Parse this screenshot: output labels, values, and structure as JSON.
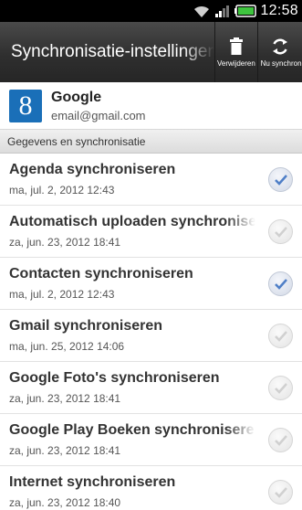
{
  "status_bar": {
    "time": "12:58",
    "icons": [
      "wifi-icon",
      "signal-icon",
      "battery-icon"
    ],
    "battery_color": "#3ec43e"
  },
  "action_bar": {
    "title": "Synchronisatie-instellingen",
    "delete_label": "Verwijderen",
    "sync_label": "Nu synchroniseren"
  },
  "account": {
    "logo_letter": "8",
    "name": "Google",
    "email": "email@gmail.com"
  },
  "section_header": "Gegevens en synchronisatie",
  "items": [
    {
      "label": "Agenda synchroniseren",
      "date": "ma, jul. 2, 2012 12:43",
      "checked": true
    },
    {
      "label": "Automatisch uploaden synchroniseren",
      "date": "za, jun. 23, 2012 18:41",
      "checked": false
    },
    {
      "label": "Contacten synchroniseren",
      "date": "ma, jul. 2, 2012 12:43",
      "checked": true
    },
    {
      "label": "Gmail synchroniseren",
      "date": "ma, jun. 25, 2012 14:06",
      "checked": false
    },
    {
      "label": "Google Foto's synchroniseren",
      "date": "za, jun. 23, 2012 18:41",
      "checked": false
    },
    {
      "label": "Google Play Boeken synchroniseren",
      "date": "za, jun. 23, 2012 18:41",
      "checked": false
    },
    {
      "label": "Internet synchroniseren",
      "date": "za, jun. 23, 2012 18:40",
      "checked": false
    }
  ],
  "colors": {
    "check_on": "#4f7fc7",
    "check_off": "#d0d0d0",
    "google_blue": "#1a6fb8"
  }
}
